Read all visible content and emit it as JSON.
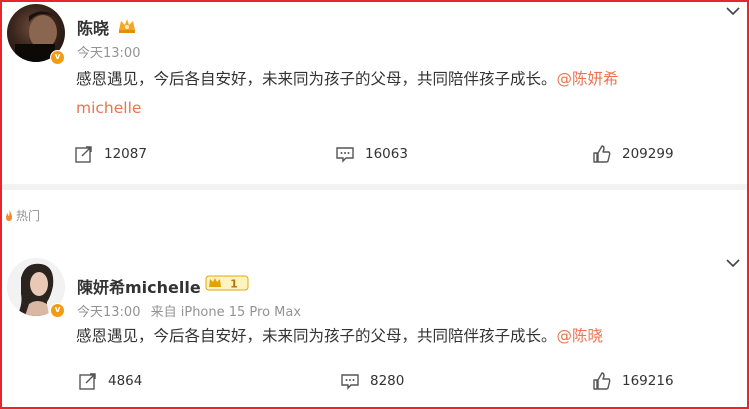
{
  "posts": [
    {
      "author": "陈晓",
      "time": "今天13:00",
      "source": "",
      "text": "感恩遇见，今后各自安好，未来同为孩子的父母，共同陪伴孩子成长。",
      "mention": "@陈妍希michelle",
      "mention_line1": "@陈妍希",
      "mention_line2": "michelle",
      "reposts": "12087",
      "comments": "16063",
      "likes": "209299"
    },
    {
      "author": "陳妍希michelle",
      "time": "今天13:00",
      "source": "来自 iPhone 15 Pro Max",
      "text": "感恩遇见，今后各自安好，未来同为孩子的父母，共同陪伴孩子成长。",
      "mention": "@陈晓",
      "reposts": "4864",
      "comments": "8280",
      "likes": "169216",
      "member_level": "1"
    }
  ],
  "section_hot_label": "热门",
  "icons": {
    "repost": "repost-icon",
    "comment": "comment-icon",
    "like": "thumbs-up-icon",
    "verified": "verified-badge-icon",
    "crown": "crown-icon",
    "chevron": "chevron-down-icon"
  },
  "colors": {
    "border": "#e8242d",
    "mention": "#eb7350",
    "verified": "#f39c12"
  }
}
